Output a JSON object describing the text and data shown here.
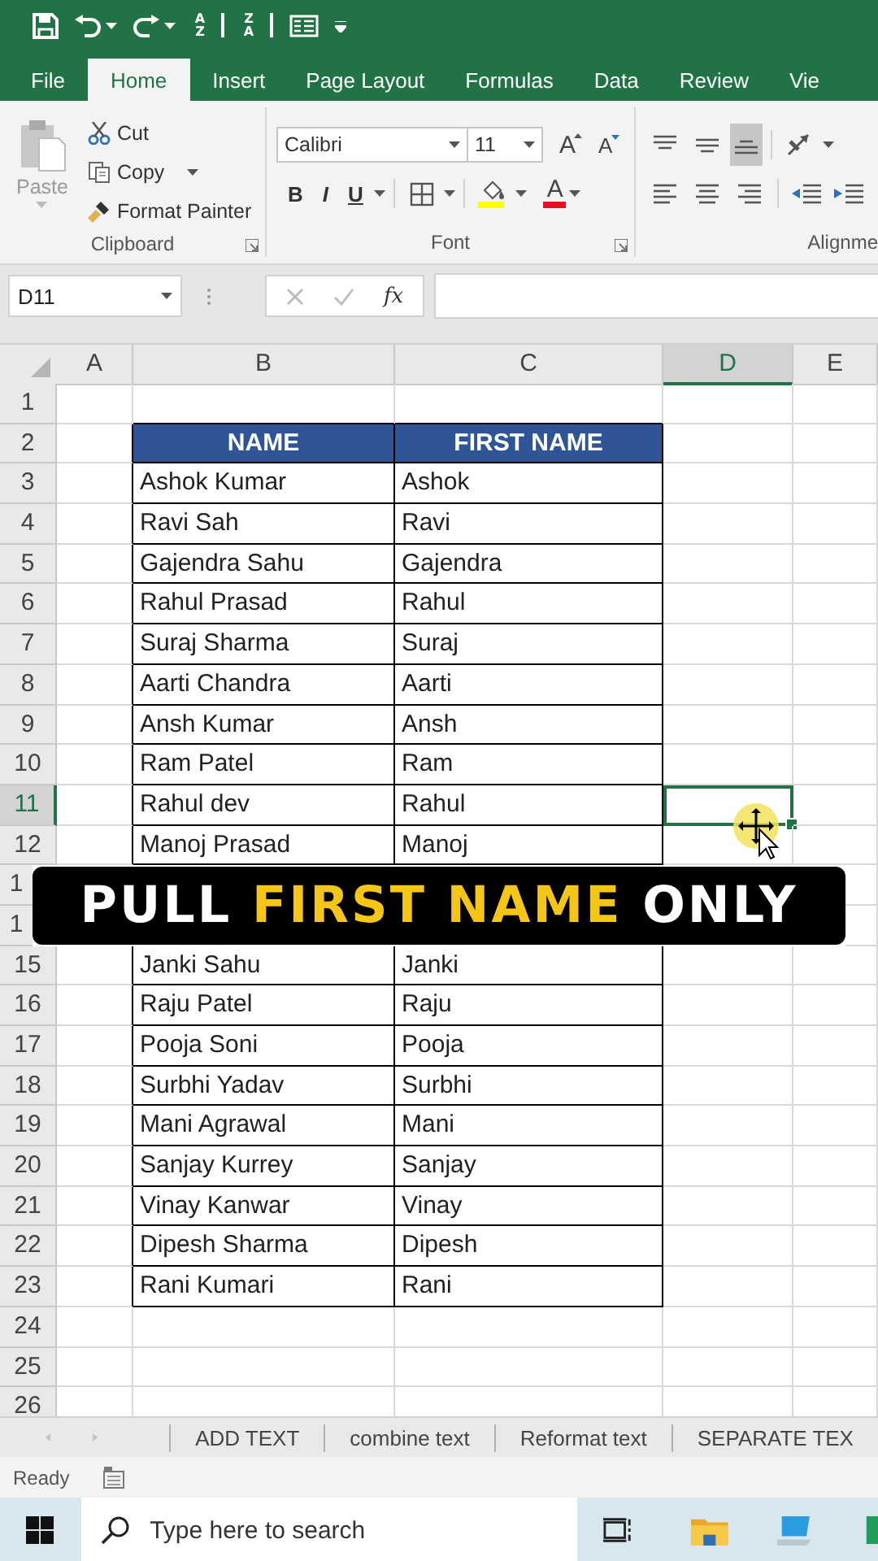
{
  "quick_access": {
    "sort_ascending": "AZ",
    "sort_descending": "ZA"
  },
  "ribbon_tabs": [
    {
      "label": "File",
      "selected": false
    },
    {
      "label": "Home",
      "selected": true
    },
    {
      "label": "Insert",
      "selected": false
    },
    {
      "label": "Page Layout",
      "selected": false
    },
    {
      "label": "Formulas",
      "selected": false
    },
    {
      "label": "Data",
      "selected": false
    },
    {
      "label": "Review",
      "selected": false
    },
    {
      "label": "Vie",
      "selected": false
    }
  ],
  "clipboard": {
    "paste": {
      "label": "Paste",
      "disabled": true
    },
    "cut": "Cut",
    "copy": "Copy",
    "format_painter": "Format Painter",
    "group": "Clipboard"
  },
  "font": {
    "name": "Calibri",
    "size": "11",
    "grow": "A",
    "shrink": "A",
    "bold": "B",
    "italic": "I",
    "underline": "U",
    "color_letter": "A",
    "group": "Font"
  },
  "alignment": {
    "group": "Alignme"
  },
  "formula_bar": {
    "name_box": "D11",
    "function": "fx"
  },
  "columns": [
    {
      "label": "A",
      "selected": false
    },
    {
      "label": "B",
      "selected": false
    },
    {
      "label": "C",
      "selected": false
    },
    {
      "label": "D",
      "selected": true
    },
    {
      "label": "E",
      "selected": false
    }
  ],
  "rows": [
    {
      "number": "1",
      "kind": "blank",
      "selected": false
    },
    {
      "number": "2",
      "kind": "header",
      "selected": false,
      "name": "NAME",
      "first_name": "FIRST NAME"
    },
    {
      "number": "3",
      "kind": "data",
      "selected": false,
      "name": "Ashok Kumar",
      "first_name": "Ashok"
    },
    {
      "number": "4",
      "kind": "data",
      "selected": false,
      "name": "Ravi Sah",
      "first_name": "Ravi"
    },
    {
      "number": "5",
      "kind": "data",
      "selected": false,
      "name": "Gajendra Sahu",
      "first_name": "Gajendra"
    },
    {
      "number": "6",
      "kind": "data",
      "selected": false,
      "name": "Rahul Prasad",
      "first_name": "Rahul"
    },
    {
      "number": "7",
      "kind": "data",
      "selected": false,
      "name": "Suraj Sharma",
      "first_name": "Suraj"
    },
    {
      "number": "8",
      "kind": "data",
      "selected": false,
      "name": "Aarti Chandra",
      "first_name": "Aarti"
    },
    {
      "number": "9",
      "kind": "data",
      "selected": false,
      "name": "Ansh Kumar",
      "first_name": "Ansh"
    },
    {
      "number": "10",
      "kind": "data",
      "selected": false,
      "name": "Ram Patel",
      "first_name": "Ram"
    },
    {
      "number": "11",
      "kind": "data",
      "selected": true,
      "name": "Rahul dev",
      "first_name": "Rahul"
    },
    {
      "number": "12",
      "kind": "data",
      "selected": false,
      "name": "Manoj Prasad",
      "first_name": "Manoj"
    },
    {
      "number": "1",
      "kind": "covered",
      "selected": false
    },
    {
      "number": "1",
      "kind": "covered",
      "selected": false
    },
    {
      "number": "15",
      "kind": "data",
      "selected": false,
      "name": "Janki Sahu",
      "first_name": "Janki"
    },
    {
      "number": "16",
      "kind": "data",
      "selected": false,
      "name": "Raju Patel",
      "first_name": "Raju"
    },
    {
      "number": "17",
      "kind": "data",
      "selected": false,
      "name": "Pooja Soni",
      "first_name": "Pooja"
    },
    {
      "number": "18",
      "kind": "data",
      "selected": false,
      "name": "Surbhi Yadav",
      "first_name": "Surbhi"
    },
    {
      "number": "19",
      "kind": "data",
      "selected": false,
      "name": "Mani Agrawal",
      "first_name": "Mani"
    },
    {
      "number": "20",
      "kind": "data",
      "selected": false,
      "name": "Sanjay Kurrey",
      "first_name": "Sanjay"
    },
    {
      "number": "21",
      "kind": "data",
      "selected": false,
      "name": "Vinay Kanwar",
      "first_name": "Vinay"
    },
    {
      "number": "22",
      "kind": "data",
      "selected": false,
      "name": "Dipesh Sharma",
      "first_name": "Dipesh"
    },
    {
      "number": "23",
      "kind": "data",
      "selected": false,
      "name": "Rani Kumari",
      "first_name": "Rani"
    },
    {
      "number": "24",
      "kind": "blank",
      "selected": false
    },
    {
      "number": "25",
      "kind": "blank",
      "selected": false
    },
    {
      "number": "26",
      "kind": "blank",
      "selected": false
    }
  ],
  "caption": [
    {
      "text": "PULL",
      "highlight": false
    },
    {
      "text": "FIRST NAME",
      "highlight": true
    },
    {
      "text": "ONLY",
      "highlight": false
    }
  ],
  "sheet_tabs": [
    "ADD TEXT",
    "combine text",
    "Reformat text",
    "SEPARATE TEX"
  ],
  "status": "Ready",
  "taskbar": {
    "search_placeholder": "Type here to search"
  }
}
